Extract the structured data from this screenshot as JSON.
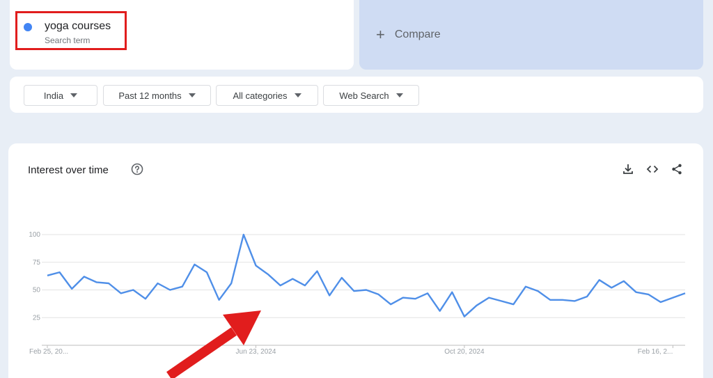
{
  "search": {
    "term": "yoga courses",
    "term_type": "Search term",
    "dot_color": "#4285f4",
    "compare_label": "Compare"
  },
  "filters": [
    {
      "label": "India"
    },
    {
      "label": "Past 12 months"
    },
    {
      "label": "All categories"
    },
    {
      "label": "Web Search"
    }
  ],
  "chart": {
    "title": "Interest over time"
  },
  "chart_data": {
    "type": "line",
    "title": "Interest over time",
    "xlabel": "",
    "ylabel": "",
    "ylim": [
      0,
      100
    ],
    "y_ticks": [
      25,
      50,
      75,
      100
    ],
    "x_tick_labels": [
      "Feb 25, 20...",
      "Jun 23, 2024",
      "Oct 20, 2024",
      "Feb 16, 2..."
    ],
    "x_tick_indices": [
      0,
      17,
      34,
      51
    ],
    "line_color": "#4f8fe8",
    "grid": true,
    "series": [
      {
        "values": [
          63,
          66,
          51,
          62,
          57,
          56,
          47,
          50,
          42,
          56,
          50,
          53,
          73,
          66,
          41,
          56,
          100,
          72,
          64,
          54,
          60,
          54,
          67,
          45,
          61,
          49,
          50,
          46,
          37,
          43,
          42,
          47,
          31,
          48,
          26,
          36,
          43,
          40,
          37,
          53,
          49,
          41,
          41,
          40,
          44,
          59,
          52,
          58,
          48,
          46,
          39,
          43,
          47
        ]
      }
    ]
  }
}
